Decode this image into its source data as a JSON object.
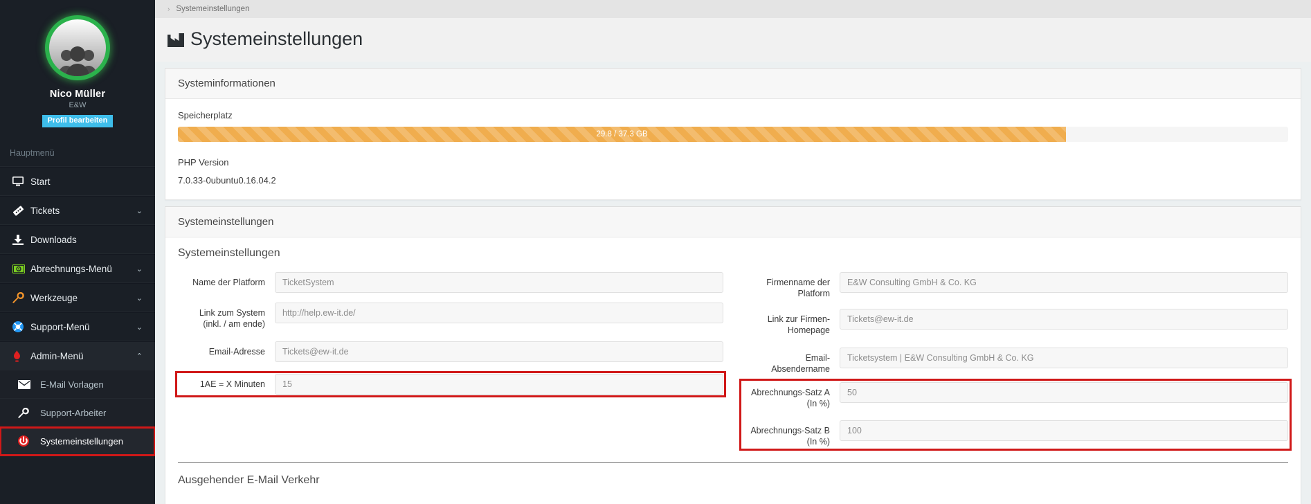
{
  "sidebar": {
    "profile": {
      "name": "Nico Müller",
      "org": "E&W",
      "edit_button": "Profil bearbeiten",
      "avatar_icon": "users-group-icon",
      "ring_color": "#2bb24c",
      "button_color": "#3ebdea"
    },
    "menu_header": "Hauptmenü",
    "items": [
      {
        "label": "Start",
        "icon": "desktop-icon",
        "caret": ""
      },
      {
        "label": "Tickets",
        "icon": "ticket-icon",
        "caret": "⌄"
      },
      {
        "label": "Downloads",
        "icon": "download-icon",
        "caret": ""
      },
      {
        "label": "Abrechnungs-Menü",
        "icon": "money-bill-icon",
        "caret": "⌄"
      },
      {
        "label": "Werkzeuge",
        "icon": "wrench-icon",
        "caret": "⌄"
      },
      {
        "label": "Support-Menü",
        "icon": "lifering-icon",
        "caret": "⌄"
      },
      {
        "label": "Admin-Menü",
        "icon": "fire-icon",
        "caret": "⌃"
      }
    ],
    "submenu": [
      {
        "label": "E-Mail Vorlagen",
        "icon": "envelope-icon"
      },
      {
        "label": "Support-Arbeiter",
        "icon": "wrench-icon"
      },
      {
        "label": "Systemeinstellungen",
        "icon": "power-icon",
        "active": true
      }
    ]
  },
  "breadcrumb": {
    "separator": "›",
    "current": "Systemeinstellungen"
  },
  "page": {
    "title": "Systemeinstellungen",
    "title_icon": "factory-icon"
  },
  "sysinfo": {
    "panel_title": "Systeminformationen",
    "storage_label": "Speicherplatz",
    "storage_text": "29.8 / 37.3 GB",
    "storage_used_gb": 29.8,
    "storage_total_gb": 37.3,
    "storage_percent": 80,
    "storage_color": "#f0ad4e",
    "php_label": "PHP Version",
    "php_value": "7.0.33-0ubuntu0.16.04.2"
  },
  "settings": {
    "panel_title": "Systemeinstellungen",
    "section_title": "Systemeinstellungen",
    "left_fields": [
      {
        "label": "Name der Platform",
        "value": "TicketSystem",
        "highlight": false
      },
      {
        "label": "Link zum System\n(inkl. / am ende)",
        "value": "http://help.ew-it.de/",
        "highlight": false
      },
      {
        "label": "Email-Adresse",
        "value": "Tickets@ew-it.de",
        "highlight": false
      },
      {
        "label": "1AE = X Minuten",
        "value": "15",
        "highlight": true
      }
    ],
    "right_fields": [
      {
        "label": "Firmenname der\nPlatform",
        "value": "E&W Consulting GmbH & Co. KG",
        "highlight": false
      },
      {
        "label": "Link zur Firmen-\nHomepage",
        "value": "Tickets@ew-it.de",
        "highlight": false
      },
      {
        "label": "Email-\nAbsendername",
        "value": "Ticketsystem | E&W Consulting GmbH & Co. KG",
        "highlight": false
      },
      {
        "label": "Abrechnungs-Satz A\n(In %)",
        "value": "50",
        "highlight": true
      },
      {
        "label": "Abrechnungs-Satz B\n(In %)",
        "value": "100",
        "highlight": true
      }
    ],
    "next_section_title": "Ausgehender E-Mail Verkehr",
    "highlight_color": "#d01818"
  }
}
